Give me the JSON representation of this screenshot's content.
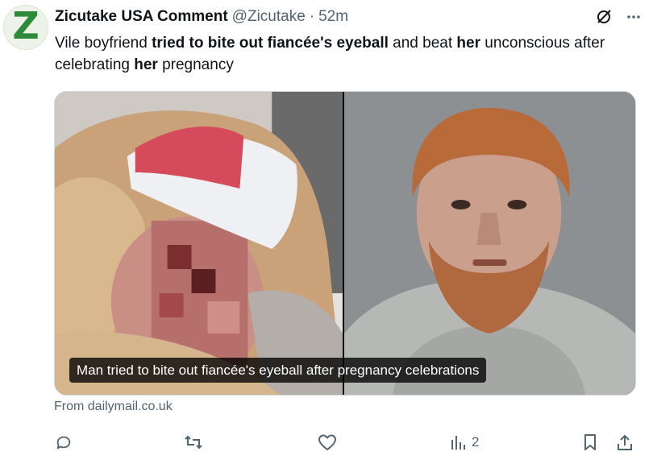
{
  "post": {
    "author_name": "Zicutake USA Comment",
    "handle": "@Zicutake",
    "separator": "·",
    "time": "52m",
    "avatar_letter": "Z",
    "text_parts": [
      {
        "t": "Vile boyfriend ",
        "b": false
      },
      {
        "t": "tried to bite out fiancée's eyeball",
        "b": true
      },
      {
        "t": " and beat ",
        "b": false
      },
      {
        "t": "her",
        "b": true
      },
      {
        "t": " unconscious after celebrating ",
        "b": false
      },
      {
        "t": "her",
        "b": true
      },
      {
        "t": " pregnancy",
        "b": false
      }
    ]
  },
  "card": {
    "caption": "Man tried to bite out fiancée's eyeball after pregnancy celebrations",
    "source": "From dailymail.co.uk"
  },
  "actions": {
    "reply_count": "",
    "repost_count": "",
    "like_count": "",
    "views_count": "2"
  },
  "icons": [
    "grok-icon",
    "more-icon",
    "reply-icon",
    "repost-icon",
    "like-icon",
    "views-icon",
    "bookmark-icon",
    "share-icon"
  ],
  "colors": {
    "text": "#0f1419",
    "muted": "#536471",
    "avatar_green": "#2e8b3a"
  }
}
